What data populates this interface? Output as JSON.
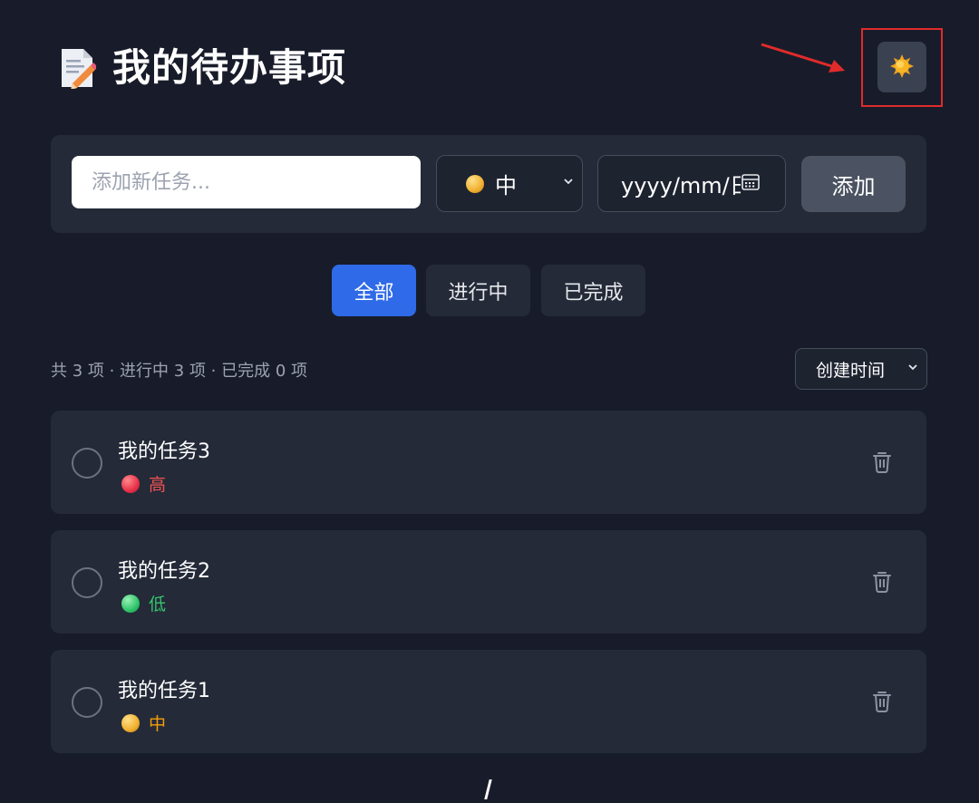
{
  "header": {
    "title": "我的待办事项",
    "title_icon": "memo-icon",
    "theme_toggle_icon": "sun-icon"
  },
  "add_form": {
    "task_placeholder": "添加新任务...",
    "priority_selected": "中",
    "date_placeholder": "yyyy/mm/日",
    "add_label": "添加"
  },
  "filters": [
    {
      "label": "全部",
      "active": true
    },
    {
      "label": "进行中",
      "active": false
    },
    {
      "label": "已完成",
      "active": false
    }
  ],
  "summary": "共 3 项 · 进行中 3 项 · 已完成 0 项",
  "sort": {
    "selected": "创建时间"
  },
  "tasks": [
    {
      "name": "我的任务3",
      "priority": "高",
      "level": "high",
      "done": false
    },
    {
      "name": "我的任务2",
      "priority": "低",
      "level": "low",
      "done": false
    },
    {
      "name": "我的任务1",
      "priority": "中",
      "level": "mid",
      "done": false
    }
  ],
  "colors": {
    "background": "#181c2a",
    "panel": "#242a38",
    "accent": "#2f6ae8",
    "high": "#f05252",
    "low": "#34c56e",
    "mid": "#f59e0b",
    "annotation": "#e02b2b"
  }
}
